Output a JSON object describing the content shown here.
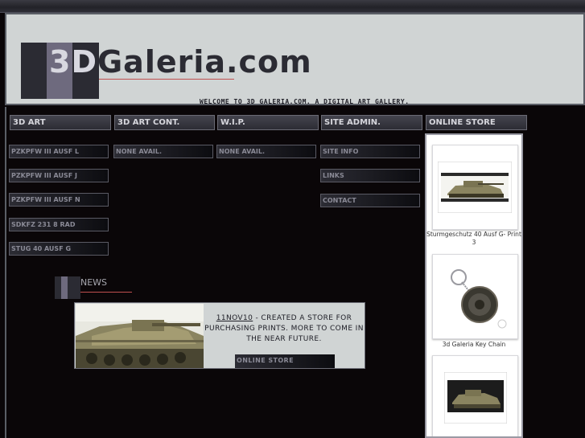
{
  "header": {
    "logo_prefix": "3D",
    "logo_name": "Galeria",
    "logo_suffix": ".com",
    "welcome": "WELCOME TO 3D GALERIA.COM. A DIGITAL ART GALLERY."
  },
  "nav": {
    "col1": {
      "heading": "3D ART",
      "items": [
        "PZKPFW III AUSF L",
        "PZKPFW III AUSF J",
        "PZKPFW III AUSF N",
        "SDKFZ 231 8 RAD",
        "STUG 40 AUSF G"
      ]
    },
    "col2": {
      "heading": "3D ART CONT.",
      "items": [
        "NONE AVAIL."
      ]
    },
    "col3": {
      "heading": "W.I.P.",
      "items": [
        "NONE AVAIL."
      ]
    },
    "col4": {
      "heading": "SITE ADMIN.",
      "items": [
        "SITE INFO",
        "LINKS",
        "CONTACT"
      ]
    },
    "col5": {
      "heading": "ONLINE STORE"
    }
  },
  "news": {
    "title": "NEWS",
    "date": "11NOV10",
    "text": " - CREATED A STORE FOR PURCHASING PRINTS. MORE TO COME IN THE NEAR FUTURE.",
    "button": "ONLINE STORE"
  },
  "store": {
    "products": [
      {
        "caption": "Sturmgeschutz 40 Ausf G- Print 3",
        "icon": "tank-print-image"
      },
      {
        "caption": "3d Galeria Key Chain",
        "icon": "keychain-image"
      },
      {
        "caption": "",
        "icon": "tank-print-image"
      }
    ]
  },
  "colors": {
    "accent_line": "#c05050",
    "header_bg": "#d0d4d4",
    "page_bg": "#0a0608"
  }
}
